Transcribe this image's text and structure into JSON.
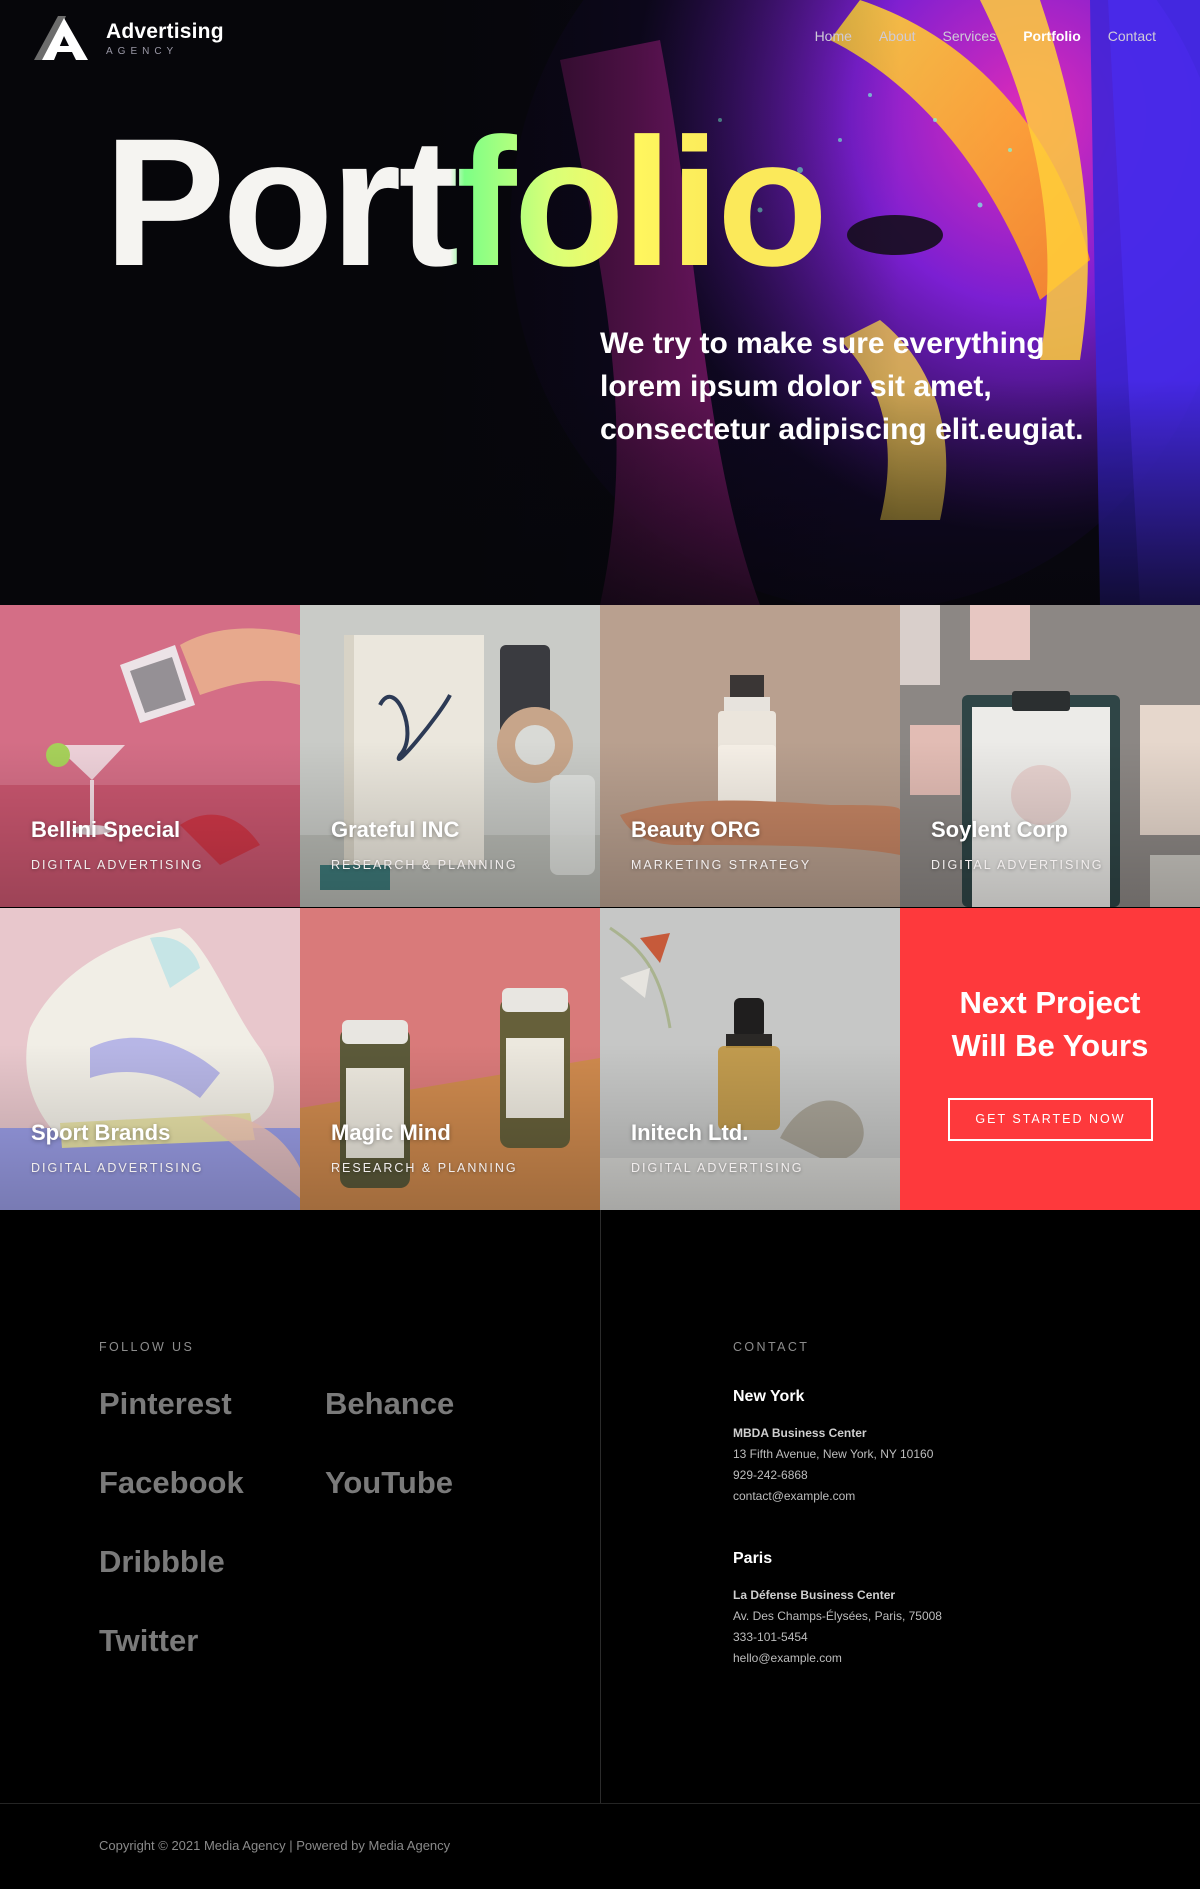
{
  "brand": {
    "name": "Advertising",
    "tagline": "AGENCY"
  },
  "nav": {
    "items": [
      "Home",
      "About",
      "Services",
      "Portfolio",
      "Contact"
    ],
    "active": "Portfolio"
  },
  "hero": {
    "title": "Portfolio",
    "subtitle": "We try to make sure everything lorem ipsum dolor sit amet, consectetur adipiscing elit.eugiat."
  },
  "portfolio": [
    {
      "title": "Bellini Special",
      "category": "DIGITAL ADVERTISING"
    },
    {
      "title": "Grateful INC",
      "category": "RESEARCH & PLANNING"
    },
    {
      "title": "Beauty ORG",
      "category": "MARKETING STRATEGY"
    },
    {
      "title": "Soylent Corp",
      "category": "DIGITAL ADVERTISING"
    },
    {
      "title": "Sport Brands",
      "category": "DIGITAL ADVERTISING"
    },
    {
      "title": "Magic Mind",
      "category": "RESEARCH & PLANNING"
    },
    {
      "title": "Initech Ltd.",
      "category": "DIGITAL ADVERTISING"
    }
  ],
  "cta": {
    "title_line1": "Next Project",
    "title_line2": "Will Be Yours",
    "button": "GET STARTED NOW",
    "color": "#fe393c"
  },
  "footer": {
    "follow_label": "FOLLOW US",
    "social": [
      "Pinterest",
      "Behance",
      "Facebook",
      "YouTube",
      "Dribbble",
      "Twitter"
    ],
    "contact_label": "CONTACT",
    "offices": [
      {
        "city": "New York",
        "building": "MBDA Business Center",
        "address": "13 Fifth Avenue, New York, NY 10160",
        "phone": "929-242-6868",
        "email": "contact@example.com"
      },
      {
        "city": "Paris",
        "building": "La Défense Business Center",
        "address": "Av. Des Champs-Élysées, Paris, 75008",
        "phone": "333-101-5454",
        "email": "hello@example.com"
      }
    ],
    "copyright": "Copyright © 2021 Media Agency | Powered by Media Agency"
  }
}
